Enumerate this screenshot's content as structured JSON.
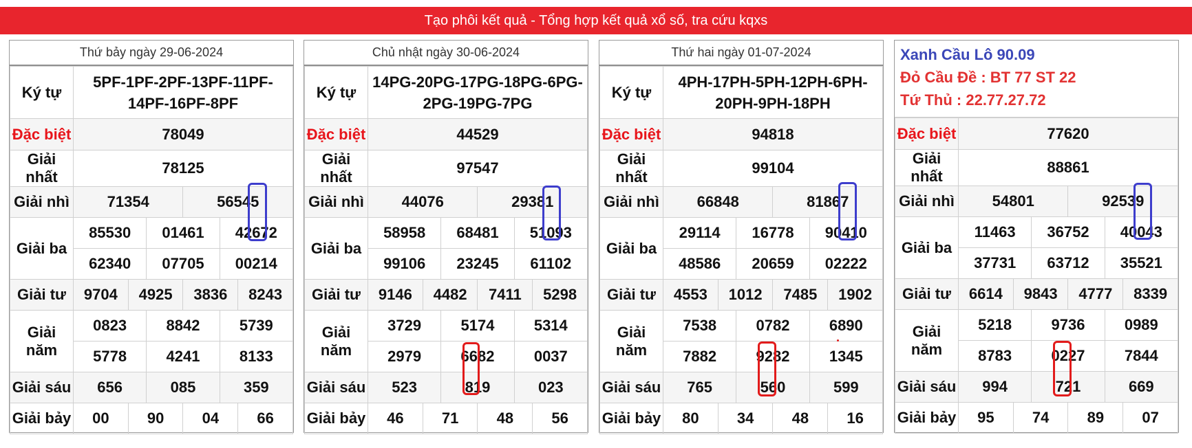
{
  "header": {
    "title": "Tạo phôi kết quả - Tổng hợp kết quả xổ số, tra cứu kqxs"
  },
  "labels": {
    "ky_tu": "Ký tự",
    "dac_biet": "Đặc biệt",
    "giai_nhat": "Giải nhất",
    "giai_nhi": "Giải nhì",
    "giai_ba": "Giải ba",
    "giai_tu": "Giải tư",
    "giai_nam": "Giải năm",
    "giai_sau": "Giải sáu",
    "giai_bay": "Giải bảy"
  },
  "note": {
    "line1": "Xanh Cầu Lô 90.09",
    "line2": "Đỏ Cầu Đề : BT 77 ST 22",
    "line3": "Tứ Thủ : 22.77.27.72"
  },
  "colors": {
    "banner": "#e8252d",
    "special_red": "#e8151b",
    "mark_blue": "#3d3dcc",
    "mark_red": "#e21b1b",
    "note_blue": "#3b47b8"
  },
  "panels": [
    {
      "title": "Thứ bảy ngày 29-06-2024",
      "ky_tu": "5PF-1PF-2PF-13PF-11PF-14PF-16PF-8PF",
      "dac_biet": "78049",
      "giai_nhat": "78125",
      "giai_nhi": [
        "71354",
        "56545"
      ],
      "giai_ba": [
        "85530",
        "01461",
        "42672",
        "62340",
        "07705",
        "00214"
      ],
      "giai_tu": [
        "9704",
        "4925",
        "3836",
        "8243"
      ],
      "giai_nam": [
        "0823",
        "8842",
        "5739",
        "5778",
        "4241",
        "8133"
      ],
      "giai_sau": [
        "656",
        "085",
        "359"
      ],
      "giai_bay": [
        "00",
        "90",
        "04",
        "66"
      ]
    },
    {
      "title": "Chủ nhật ngày 30-06-2024",
      "ky_tu": "14PG-20PG-17PG-18PG-6PG-2PG-19PG-7PG",
      "dac_biet": "44529",
      "giai_nhat": "97547",
      "giai_nhi": [
        "44076",
        "29381"
      ],
      "giai_ba": [
        "58958",
        "68481",
        "51093",
        "99106",
        "23245",
        "61102"
      ],
      "giai_tu": [
        "9146",
        "4482",
        "7411",
        "5298"
      ],
      "giai_nam": [
        "3729",
        "5174",
        "5314",
        "2979",
        "6682",
        "0037"
      ],
      "giai_sau": [
        "523",
        "819",
        "023"
      ],
      "giai_bay": [
        "46",
        "71",
        "48",
        "56"
      ]
    },
    {
      "title": "Thứ hai ngày 01-07-2024",
      "ky_tu": "4PH-17PH-5PH-12PH-6PH-20PH-9PH-18PH",
      "dac_biet": "94818",
      "giai_nhat": "99104",
      "giai_nhi": [
        "66848",
        "81867"
      ],
      "giai_ba": [
        "29114",
        "16778",
        "90410",
        "48586",
        "20659",
        "02222"
      ],
      "giai_tu": [
        "4553",
        "1012",
        "7485",
        "1902"
      ],
      "giai_nam": [
        "7538",
        "0782",
        "6890",
        "7882",
        "9282",
        "1345"
      ],
      "giai_sau": [
        "765",
        "560",
        "599"
      ],
      "giai_bay": [
        "80",
        "34",
        "48",
        "16"
      ]
    },
    {
      "dac_biet": "77620",
      "giai_nhat": "88861",
      "giai_nhi": [
        "54801",
        "92539"
      ],
      "giai_ba": [
        "11463",
        "36752",
        "40043",
        "37731",
        "63712",
        "35521"
      ],
      "giai_tu": [
        "6614",
        "9843",
        "4777",
        "8339"
      ],
      "giai_nam": [
        "5218",
        "9736",
        "0989",
        "8783",
        "0227",
        "7844"
      ],
      "giai_sau": [
        "994",
        "721",
        "669"
      ],
      "giai_bay": [
        "95",
        "74",
        "89",
        "07"
      ]
    }
  ]
}
